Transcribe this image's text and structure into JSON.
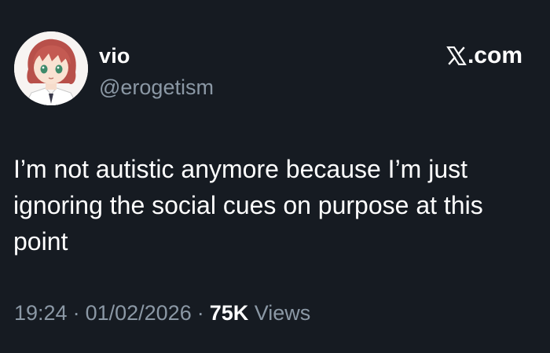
{
  "author": {
    "display_name": "vio",
    "handle": "@erogetism"
  },
  "brand": {
    "label": ".com",
    "icon": "x-logo-icon"
  },
  "tweet": {
    "text": "I’m not autistic anymore because I’m just ignoring the social cues on purpose at this point"
  },
  "meta": {
    "time": "19:24",
    "separator": "·",
    "date": "01/02/2026",
    "views_count": "75K",
    "views_label": "Views"
  },
  "colors": {
    "background": "#161b22",
    "text_primary": "#ffffff",
    "text_secondary": "#8b98a5"
  }
}
